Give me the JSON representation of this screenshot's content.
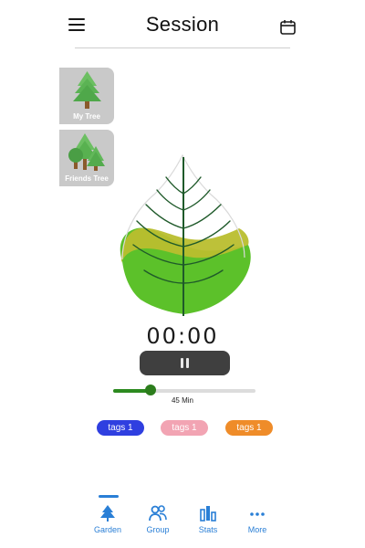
{
  "header": {
    "title": "Session"
  },
  "cards": {
    "my_tree_label": "My Tree",
    "friends_tree_label": "Friends Tree"
  },
  "timer": {
    "display": "00:00"
  },
  "duration": {
    "label": "45 Min",
    "fraction": 0.26
  },
  "tags": [
    {
      "label": "tags 1",
      "color": "#2f3fe0"
    },
    {
      "label": "tags 1",
      "color": "#f2a4b3"
    },
    {
      "label": "tags 1",
      "color": "#ef8c29"
    }
  ],
  "nav": {
    "items": [
      {
        "label": "Garden",
        "icon": "tree-icon",
        "active": true
      },
      {
        "label": "Group",
        "icon": "group-icon",
        "active": false
      },
      {
        "label": "Stats",
        "icon": "stats-icon",
        "active": false
      },
      {
        "label": "More",
        "icon": "more-dots-icon",
        "active": false
      }
    ],
    "active_color": "#2a7fd6"
  },
  "colors": {
    "leaf_green": "#5cc12a",
    "leaf_band": "#b9be2e",
    "pause_button": "#3f3f3f",
    "slider_fill": "#2c8a1f"
  }
}
